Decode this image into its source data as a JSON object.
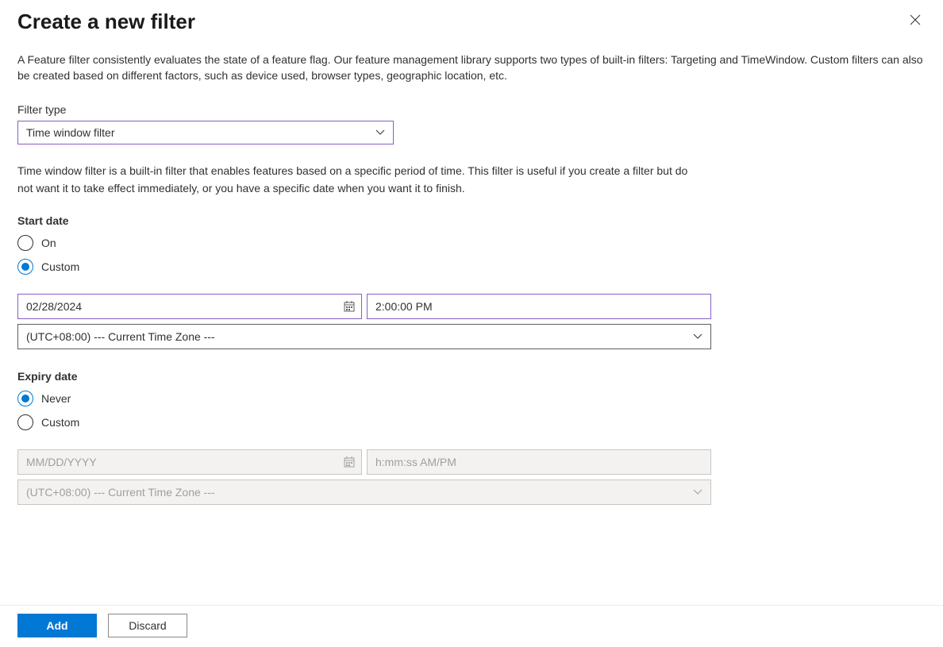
{
  "header": {
    "title": "Create a new filter"
  },
  "description": "A Feature filter consistently evaluates the state of a feature flag. Our feature management library supports two types of built-in filters: Targeting and TimeWindow. Custom filters can also be created based on different factors, such as device used, browser types, geographic location, etc.",
  "filterType": {
    "label": "Filter type",
    "selected": "Time window filter"
  },
  "filterHelper": "Time window filter is a built-in filter that enables features based on a specific period of time. This filter is useful if you create a filter but do not want it to take effect immediately, or you have a specific date when you want it to finish.",
  "startDate": {
    "label": "Start date",
    "options": {
      "on": "On",
      "custom": "Custom"
    },
    "selected": "custom",
    "date": "02/28/2024",
    "time": "2:00:00 PM",
    "timezone": "(UTC+08:00) --- Current Time Zone ---"
  },
  "expiryDate": {
    "label": "Expiry date",
    "options": {
      "never": "Never",
      "custom": "Custom"
    },
    "selected": "never",
    "datePlaceholder": "MM/DD/YYYY",
    "timePlaceholder": "h:mm:ss AM/PM",
    "timezone": "(UTC+08:00) --- Current Time Zone ---"
  },
  "footer": {
    "add": "Add",
    "discard": "Discard"
  }
}
